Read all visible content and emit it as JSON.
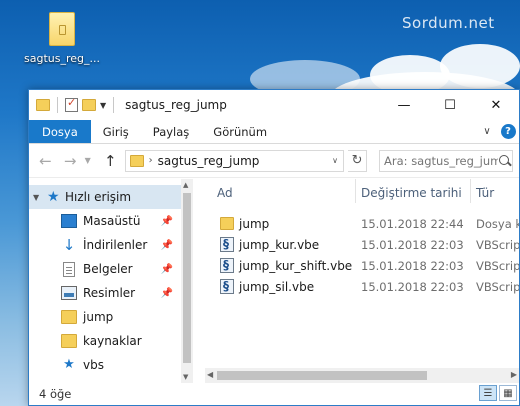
{
  "desktop": {
    "icon_label": "sagtus_reg_...",
    "watermark": "Sordum.net"
  },
  "window": {
    "title": "sagtus_reg_jump",
    "controls": {
      "minimize": "—",
      "maximize": "☐",
      "close": "✕"
    }
  },
  "ribbon": {
    "tabs": [
      {
        "label": "Dosya"
      },
      {
        "label": "Giriş"
      },
      {
        "label": "Paylaş"
      },
      {
        "label": "Görünüm"
      }
    ],
    "help": "?"
  },
  "address": {
    "path": "sagtus_reg_jump",
    "search_placeholder": "Ara: sagtus_reg_jump"
  },
  "nav": {
    "quick_access": "Hızlı erişim",
    "items": [
      {
        "label": "Masaüstü",
        "icon": "desktop-icon",
        "pinned": true
      },
      {
        "label": "İndirilenler",
        "icon": "download-icon",
        "pinned": true
      },
      {
        "label": "Belgeler",
        "icon": "documents-icon",
        "pinned": true
      },
      {
        "label": "Resimler",
        "icon": "pictures-icon",
        "pinned": true
      },
      {
        "label": "jump",
        "icon": "folder-icon",
        "pinned": false
      },
      {
        "label": "kaynaklar",
        "icon": "folder-icon",
        "pinned": false
      },
      {
        "label": "vbs",
        "icon": "vbs-icon",
        "pinned": false
      }
    ]
  },
  "columns": {
    "name": "Ad",
    "date": "Değiştirme tarihi",
    "type": "Tür"
  },
  "files": [
    {
      "name": "jump",
      "date": "15.01.2018 22:44",
      "type": "Dosya kla",
      "icon": "folder-icon"
    },
    {
      "name": "jump_kur.vbe",
      "date": "15.01.2018 22:03",
      "type": "VBScript",
      "icon": "vbe-file-icon"
    },
    {
      "name": "jump_kur_shift.vbe",
      "date": "15.01.2018 22:03",
      "type": "VBScript",
      "icon": "vbe-file-icon"
    },
    {
      "name": "jump_sil.vbe",
      "date": "15.01.2018 22:03",
      "type": "VBScript",
      "icon": "vbe-file-icon"
    }
  ],
  "status": {
    "count": "4 öğe"
  },
  "colors": {
    "accent": "#1979ca",
    "selection": "#d8e6f2",
    "folder": "#f5cf5a"
  }
}
